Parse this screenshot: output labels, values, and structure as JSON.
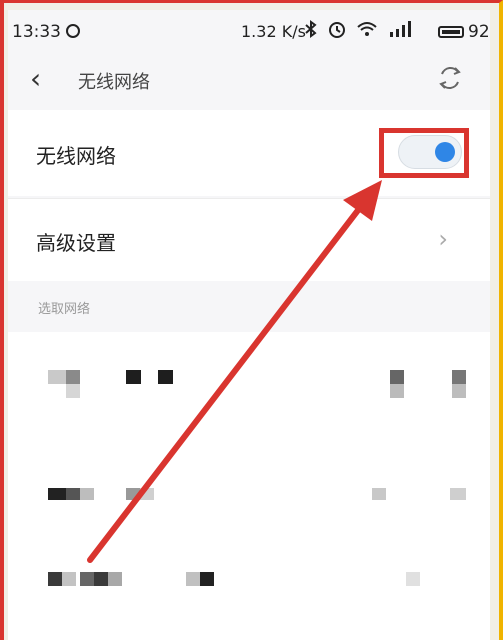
{
  "status_bar": {
    "time": "13:33",
    "speed": "1.32 K/s",
    "battery": "92",
    "icons": [
      "bluetooth-icon",
      "alarm-icon",
      "wifi-icon",
      "signal-icon",
      "battery-icon"
    ]
  },
  "header": {
    "title": "无线网络",
    "back_icon": "chevron-left-icon",
    "refresh_icon": "refresh-icon"
  },
  "settings": {
    "wifi_label": "无线网络",
    "wifi_enabled": true,
    "advanced_label": "高级设置",
    "advanced_chevron": "chevron-right-icon"
  },
  "networks": {
    "section_label": "选取网络"
  },
  "colors": {
    "toggle_on": "#2f86e6",
    "annotation_red": "#d9352f"
  }
}
